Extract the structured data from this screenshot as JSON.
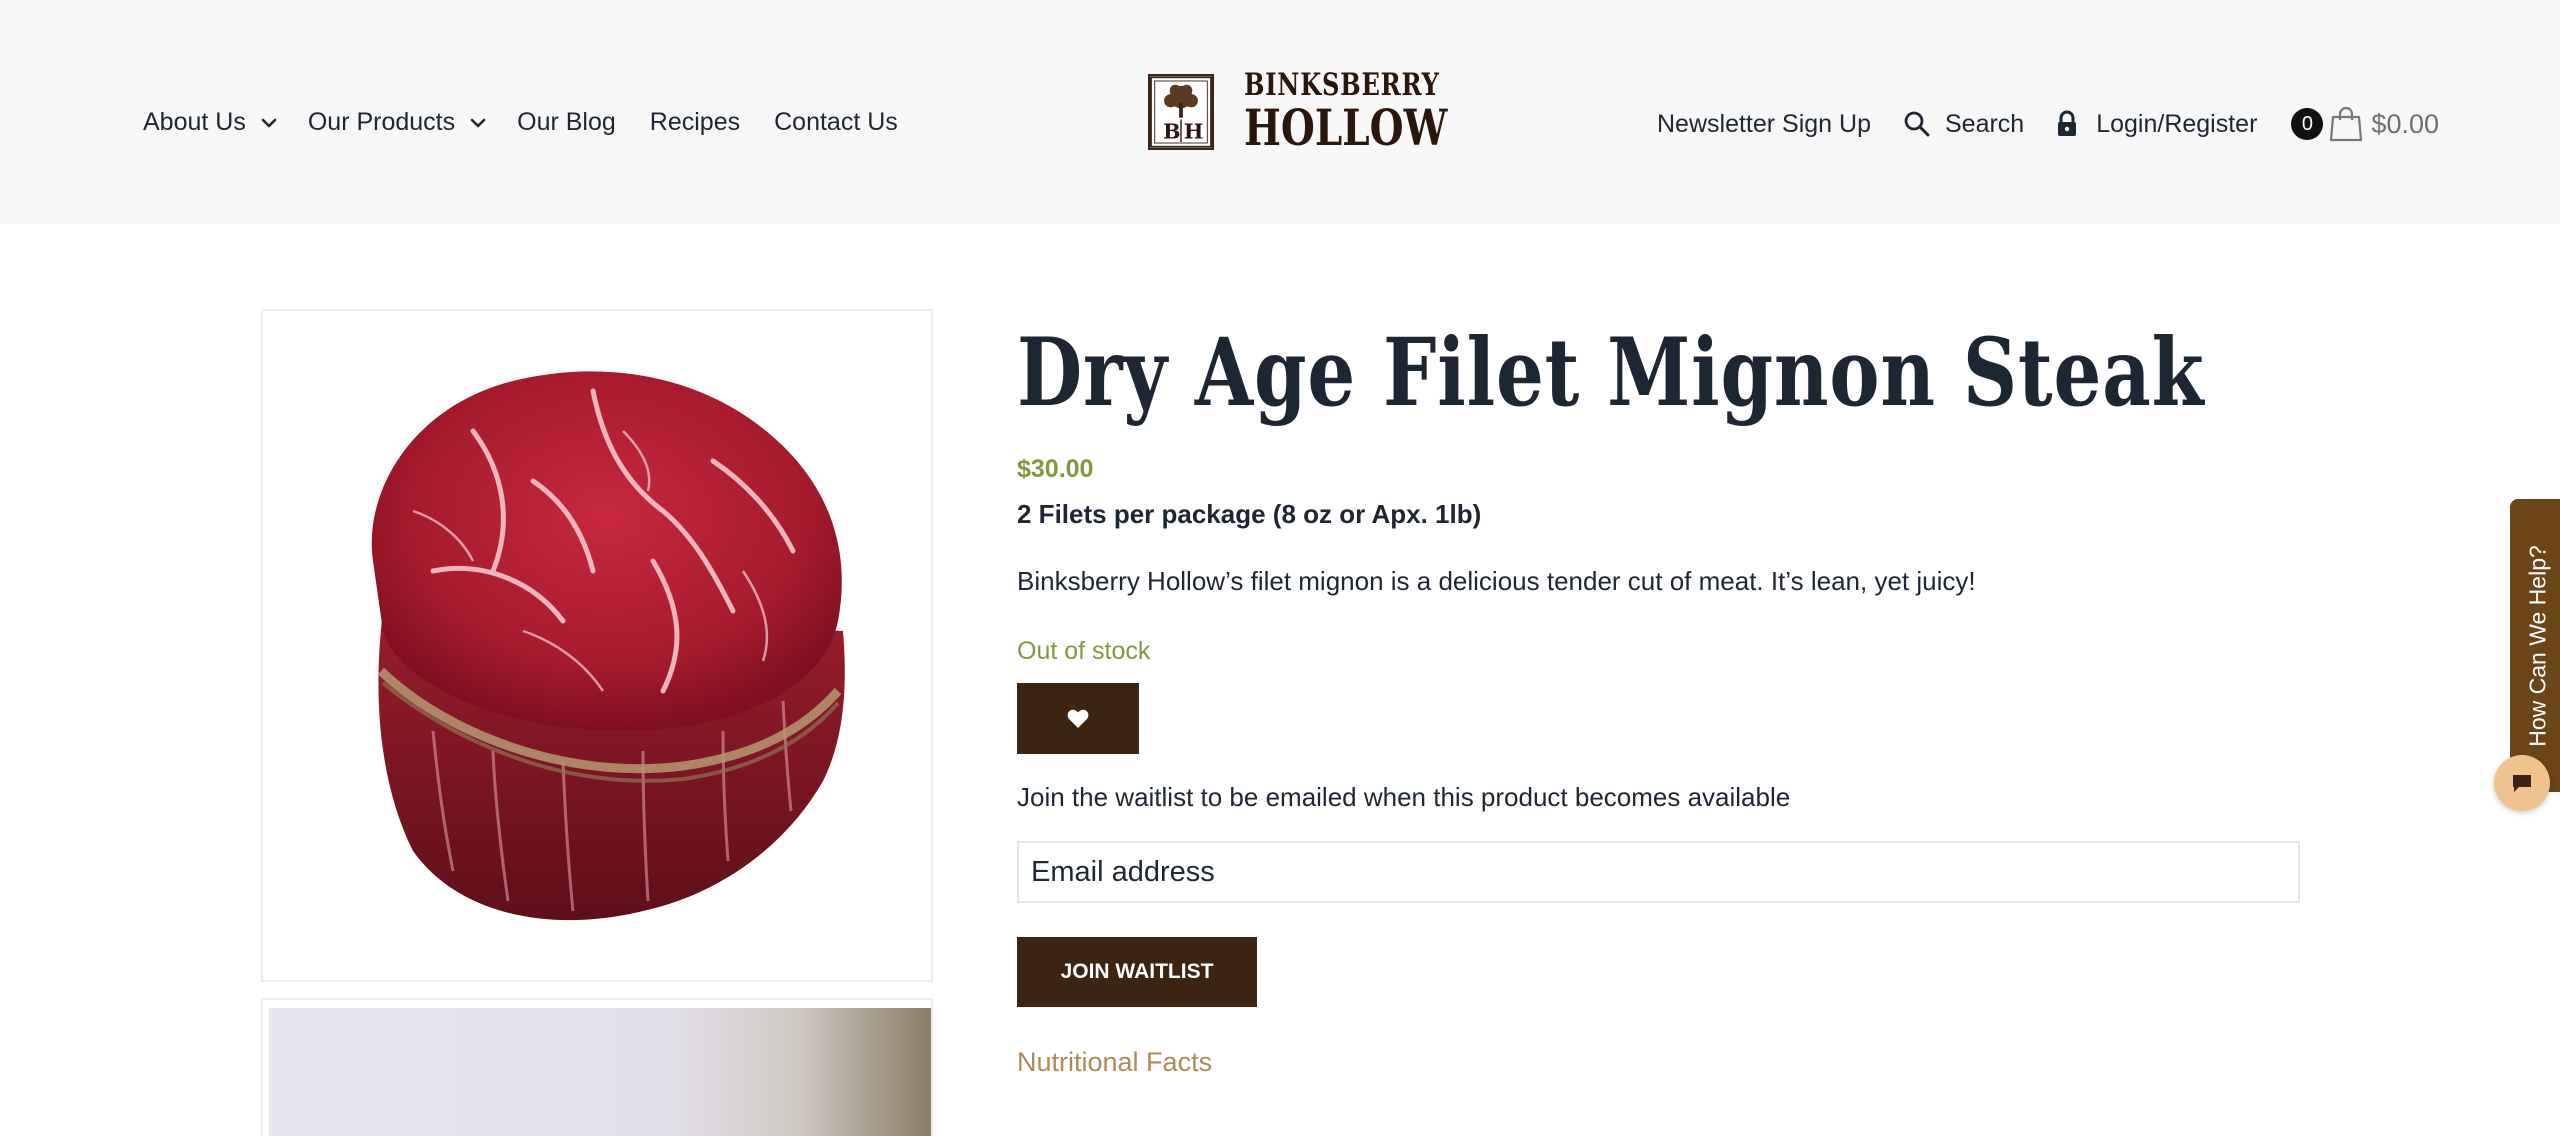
{
  "header": {
    "nav_left": [
      {
        "label": "About Us",
        "has_dropdown": true
      },
      {
        "label": "Our Products",
        "has_dropdown": true
      },
      {
        "label": "Our Blog",
        "has_dropdown": false
      },
      {
        "label": "Recipes",
        "has_dropdown": false
      },
      {
        "label": "Contact Us",
        "has_dropdown": false
      }
    ],
    "logo": {
      "monogram": "BH",
      "top": "BINKSBERRY",
      "bottom": "HOLLOW"
    },
    "newsletter_label": "Newsletter Sign Up",
    "search_label": "Search",
    "login_label": "Login/Register",
    "cart_count": "0",
    "cart_total": "$0.00"
  },
  "product": {
    "title": "Dry Age Filet Mignon Steak",
    "price": "$30.00",
    "package": "2 Filets per package (8 oz or Apx. 1lb)",
    "description": "Binksberry Hollow’s filet mignon is a delicious tender cut of meat. It’s lean, yet juicy!",
    "stock_status": "Out of stock",
    "waitlist_text": "Join the waitlist to be emailed when this product becomes available",
    "email_placeholder": "Email address",
    "join_button": "JOIN WAITLIST",
    "nutrition_link": "Nutritional Facts"
  },
  "help": {
    "tab_label": "How Can We Help?"
  },
  "colors": {
    "brand_brown": "#3d2410",
    "price_green": "#7f9a3e",
    "link_tan": "#b08a56",
    "help_tab": "#6b4418"
  }
}
